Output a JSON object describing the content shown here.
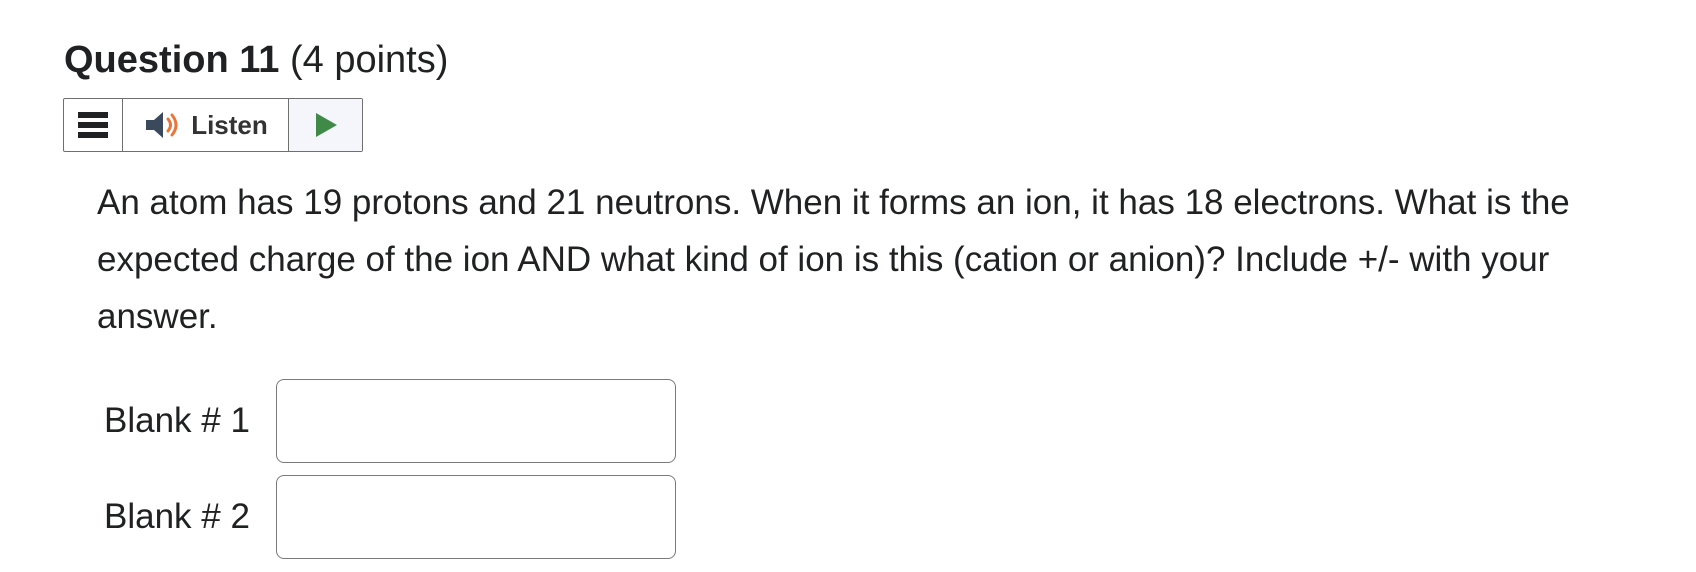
{
  "question": {
    "title": "Question 11",
    "points": "(4 points)"
  },
  "toolbar": {
    "menu_icon": "hamburger-menu-icon",
    "listen_icon": "speaker-icon",
    "listen_label": "Listen",
    "play_icon": "play-icon",
    "play_color": "#3f8a46",
    "speaker_wave_color": "#e8763a"
  },
  "body": {
    "text": "An atom has 19 protons and 21 neutrons.  When it forms an ion, it has 18 electrons. What is the expected charge of the ion AND what kind of ion is this (cation or anion)?  Include +/- with your answer."
  },
  "blanks": [
    {
      "label": "Blank # 1",
      "value": ""
    },
    {
      "label": "Blank # 2",
      "value": ""
    }
  ]
}
